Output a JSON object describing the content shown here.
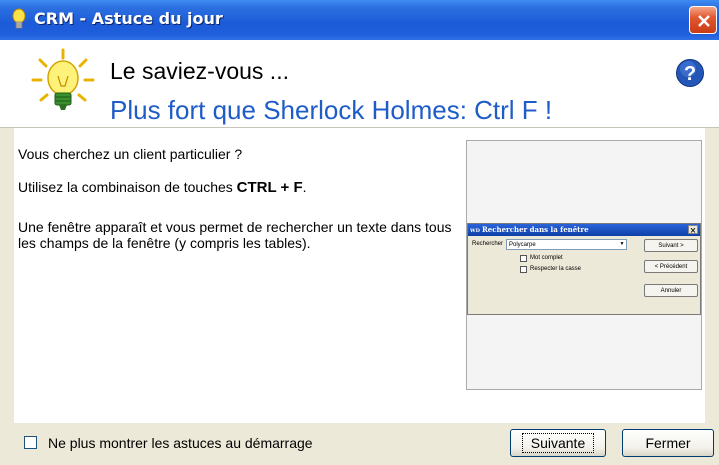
{
  "window": {
    "title": "CRM - Astuce du jour",
    "title_icon": "lightbulb-icon",
    "close_icon": "close-icon"
  },
  "header": {
    "title": "Le saviez-vous ...",
    "tip_title": "Plus fort que Sherlock Holmes: Ctrl F !",
    "bulb_icon": "lightbulb-icon",
    "help_icon": "help-icon"
  },
  "content": {
    "line1": "Vous cherchez un client particulier ?",
    "line2_prefix": "Utilisez la combinaison de touches ",
    "line2_keys": "CTRL + F",
    "line2_suffix": ".",
    "line3": "Une fenêtre apparaît et vous permet de rechercher un texte dans tous les champs de la fenêtre (y compris les tables)."
  },
  "preview": {
    "dialog_title": "Rechercher dans la fenêtre",
    "dialog_logo": "WD",
    "search_label": "Rechercher",
    "search_value": "Polycarpe",
    "option_whole_word": "Mot complet",
    "option_match_case": "Respecter la casse",
    "next_label": "Suivant >",
    "prev_label": "< Précédent",
    "cancel_label": "Annuler"
  },
  "footer": {
    "checkbox_label": "Ne plus montrer les astuces au démarrage",
    "next_button": "Suivante",
    "close_button": "Fermer"
  },
  "colors": {
    "titlebar": "#1f5fdc",
    "tip_text": "#1e5cc8",
    "close": "#e2582f"
  }
}
